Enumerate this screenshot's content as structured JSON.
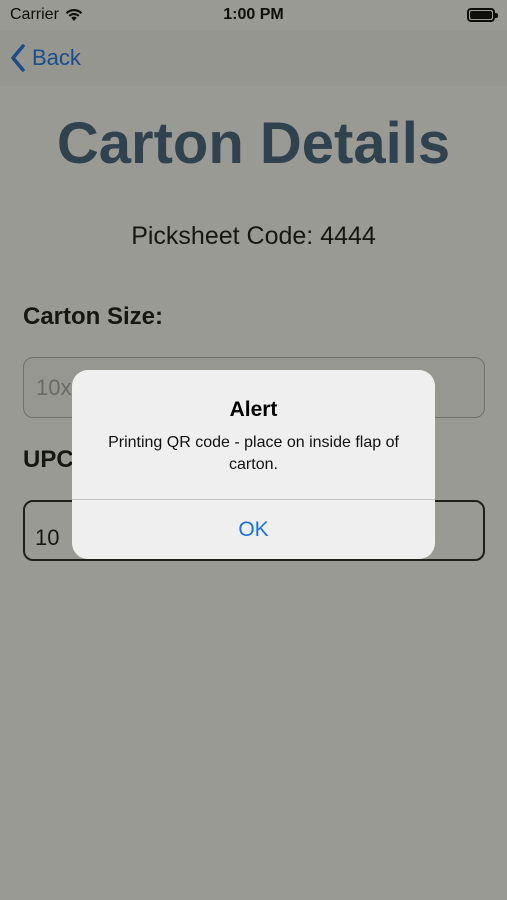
{
  "status_bar": {
    "carrier": "Carrier",
    "time": "1:00 PM"
  },
  "nav": {
    "back_label": "Back"
  },
  "screen": {
    "title": "Carton Details",
    "picksheet_label": "Picksheet Code:",
    "picksheet_code": "4444",
    "carton_size_label": "Carton Size:",
    "carton_size_value": "10x",
    "upc_label": "UPC",
    "upc_value": "10"
  },
  "alert": {
    "title": "Alert",
    "message": "Printing QR code - place on inside flap of carton.",
    "ok_label": "OK"
  },
  "colors": {
    "accent": "#1a73e8",
    "title": "#3d5f7e"
  }
}
